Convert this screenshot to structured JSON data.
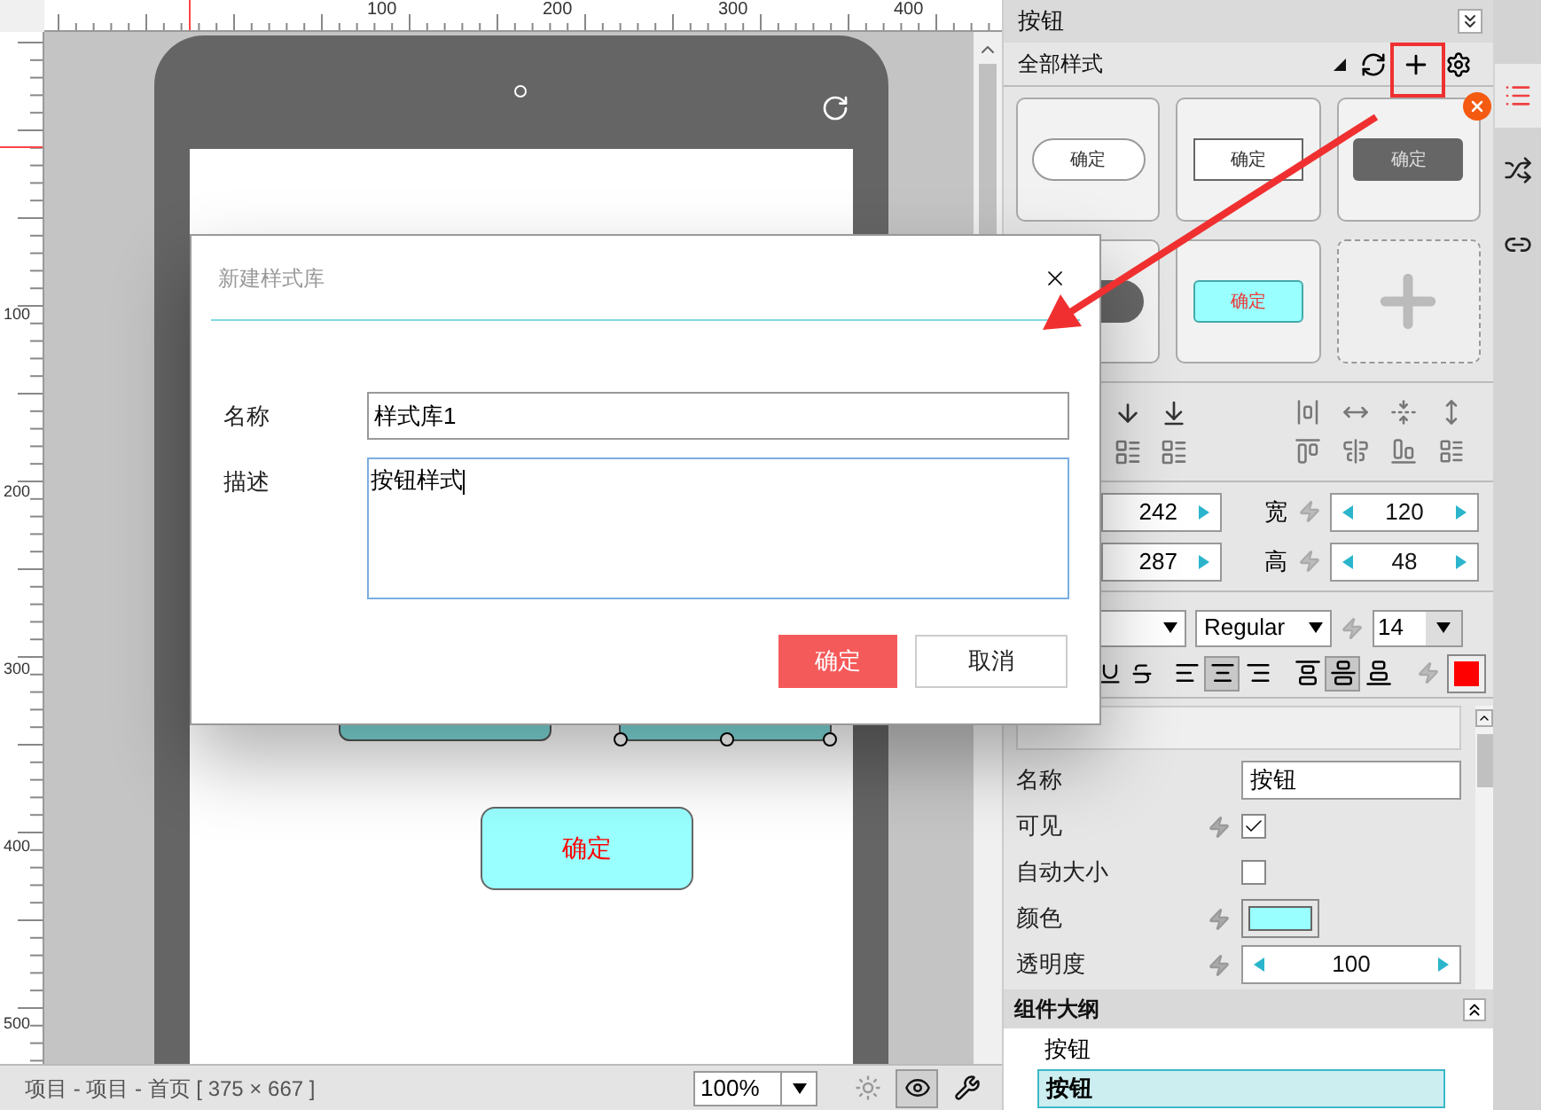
{
  "rulers": {
    "top_labels": [
      "100",
      "200",
      "300",
      "400"
    ],
    "left_labels": [
      "100",
      "200",
      "300",
      "400",
      "500"
    ]
  },
  "canvas": {
    "widgets": [
      {
        "kind": "partial",
        "selected": false
      },
      {
        "kind": "partial",
        "selected": true
      },
      {
        "kind": "button",
        "label": "确定",
        "selected": false
      }
    ]
  },
  "dialog": {
    "title": "新建样式库",
    "fields": [
      {
        "kind": "line",
        "label": "名称",
        "value": "样式库1"
      },
      {
        "kind": "area",
        "label": "描述",
        "value": "按钮样式"
      }
    ],
    "buttons": [
      {
        "kind": "primary",
        "label": "确定"
      },
      {
        "kind": "secondary",
        "label": "取消"
      }
    ]
  },
  "panel": {
    "title": "按钮",
    "style_filter": "全部样式",
    "styles": [
      {
        "kind": "pill",
        "label": "确定"
      },
      {
        "kind": "outline",
        "label": "确定"
      },
      {
        "kind": "dark",
        "label": "确定"
      },
      {
        "kind": "dark-round"
      },
      {
        "kind": "cyan",
        "label": "确定"
      },
      {
        "kind": "add"
      }
    ],
    "position": [
      {
        "value": "242"
      },
      {
        "value": "287"
      }
    ],
    "size": [
      {
        "label": "宽",
        "value": "120"
      },
      {
        "label": "高",
        "value": "48"
      }
    ],
    "font": {
      "weight": "Regular",
      "size": "14",
      "color": "#ff0000"
    },
    "text_align": [
      {
        "selected": false
      },
      {
        "selected": true
      },
      {
        "selected": false
      }
    ],
    "vertical_align": [
      {
        "selected": false
      },
      {
        "selected": true
      },
      {
        "selected": false
      }
    ],
    "properties": [
      {
        "kind": "text",
        "label": "名称",
        "value": "按钮",
        "bolt": false
      },
      {
        "kind": "check",
        "label": "可见",
        "checked": true,
        "bolt": true
      },
      {
        "kind": "check",
        "label": "自动大小",
        "checked": false,
        "bolt": false
      },
      {
        "kind": "color",
        "label": "颜色",
        "color": "#99ffff",
        "bolt": true
      },
      {
        "kind": "spinner",
        "label": "透明度",
        "value": "100",
        "bolt": true
      }
    ]
  },
  "outline": {
    "title": "组件大纲",
    "items": [
      {
        "label": "按钮",
        "selected": false
      },
      {
        "label": "按钮",
        "selected": true
      }
    ]
  },
  "side_tabs": [
    {
      "kind": "styles",
      "selected": true
    },
    {
      "kind": "interactions",
      "selected": false
    },
    {
      "kind": "links",
      "selected": false
    }
  ],
  "status_bar": {
    "path": "项目 - 项目 - 首页 [ 375 × 667 ]",
    "zoom": "100%",
    "tools": [
      {
        "kind": "sun",
        "selected": false
      },
      {
        "kind": "eye",
        "selected": true
      },
      {
        "kind": "wrench",
        "selected": false
      }
    ]
  }
}
